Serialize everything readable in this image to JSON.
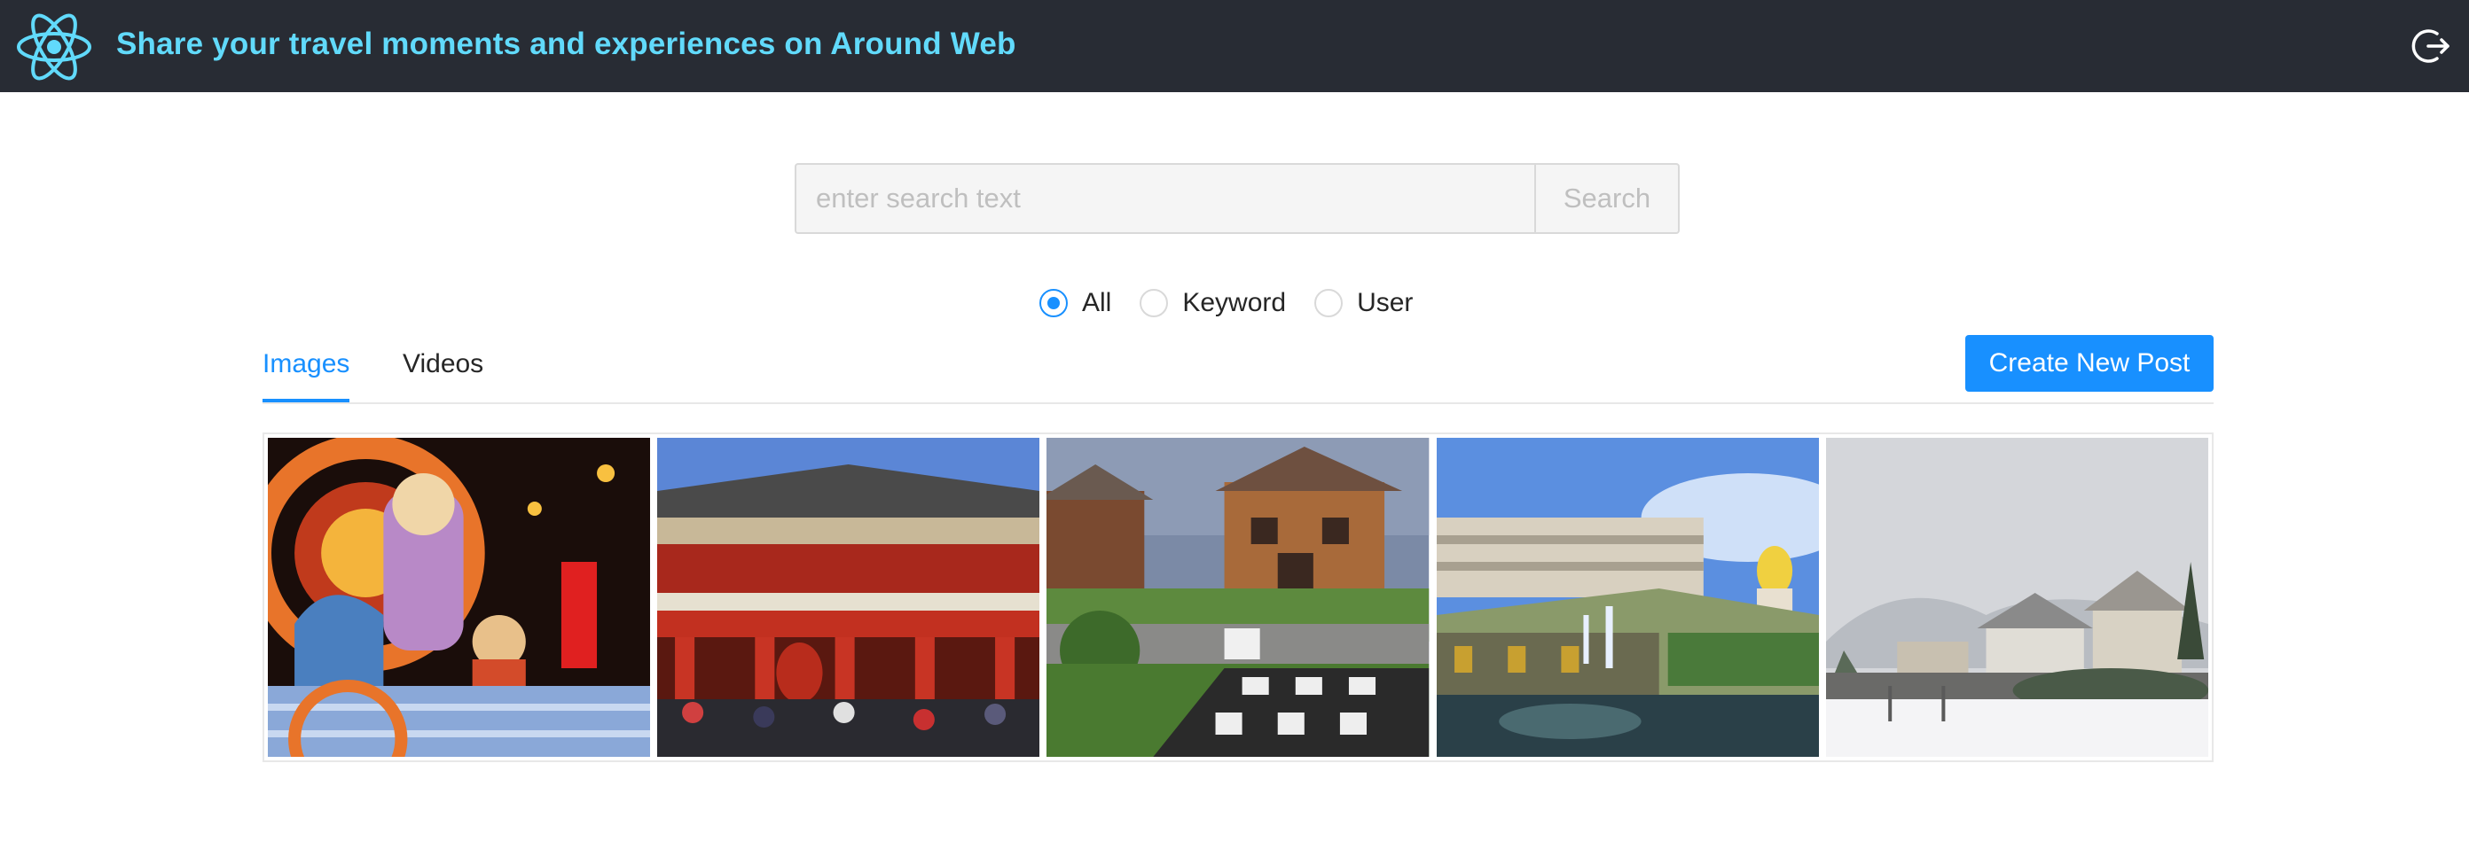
{
  "header": {
    "title": "Share your travel moments and experiences on Around Web",
    "logo_icon": "react-atom-icon",
    "logout_icon": "logout-icon",
    "accent_color": "#61dafb",
    "background_color": "#282c34"
  },
  "search": {
    "placeholder": "enter search text",
    "value": "",
    "button_label": "Search"
  },
  "filter": {
    "options": [
      "All",
      "Keyword",
      "User"
    ],
    "selected": "All"
  },
  "tabs": [
    {
      "label": "Images",
      "active": true
    },
    {
      "label": "Videos",
      "active": false
    }
  ],
  "create_button_label": "Create New Post",
  "primary_color": "#1890ff",
  "gallery": {
    "images": [
      {
        "subject": "lantern-festival-photo"
      },
      {
        "subject": "temple-gate-photo"
      },
      {
        "subject": "wooden-house-chess-photo"
      },
      {
        "subject": "palace-fountain-photo"
      },
      {
        "subject": "snowy-village-photo"
      }
    ]
  }
}
